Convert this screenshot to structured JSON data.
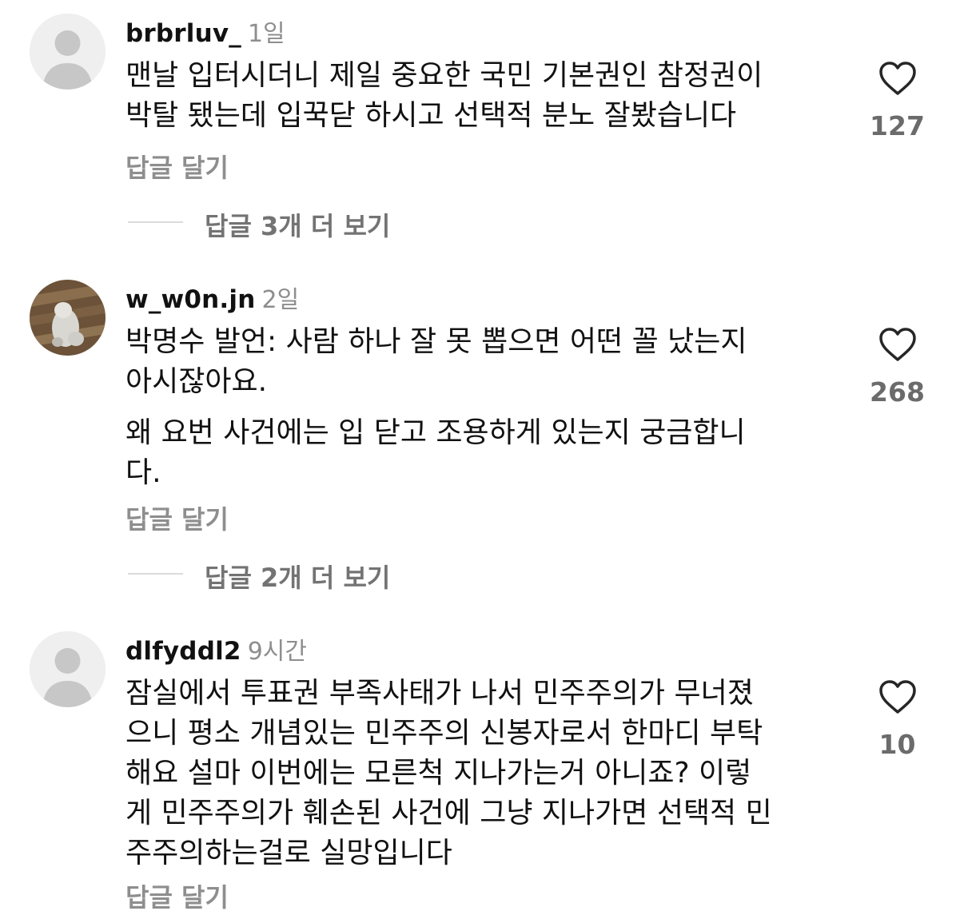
{
  "comments": [
    {
      "username": "brbrluv_",
      "time": "1일",
      "avatar_icon": "default-avatar",
      "lines": [
        "맨날 입터시더니 제일 중요한 국민 기본권인 참정권이",
        "박탈 됐는데 입꾹닫 하시고 선택적 분노 잘봤습니다"
      ],
      "reply_label": "답글 달기",
      "likes": "127",
      "view_replies": "답글 3개 더 보기"
    },
    {
      "username": "w_w0n.jn",
      "time": "2일",
      "avatar_icon": "photo-avatar",
      "paragraph1": [
        "박명수 발언: 사람 하나 잘 못 뽑으면 어떤 꼴 났는지",
        "아시잖아요."
      ],
      "paragraph2": [
        "왜 요번 사건에는 입 닫고 조용하게 있는지 궁금합니",
        "다."
      ],
      "reply_label": "답글 달기",
      "likes": "268",
      "view_replies": "답글 2개 더 보기"
    },
    {
      "username": "dlfyddl2",
      "time": "9시간",
      "avatar_icon": "default-avatar",
      "lines": [
        "잠실에서 투표권 부족사태가 나서 민주주의가 무너졌",
        "으니 평소 개념있는 민주주의 신봉자로서 한마디 부탁",
        "해요 설마 이번에는 모른척 지나가는거 아니죠? 이렇",
        "게 민주주의가 훼손된 사건에 그냥 지나가면 선택적 민",
        "주주의하는걸로 실망입니다"
      ],
      "reply_label": "답글 달기",
      "likes": "10"
    }
  ],
  "icons": {
    "like": "heart-outline-icon"
  },
  "colors": {
    "text": "#111111",
    "secondary": "#8e8e8e",
    "avatar_bg": "#efefef",
    "avatar_fg": "#c7c7c7"
  }
}
